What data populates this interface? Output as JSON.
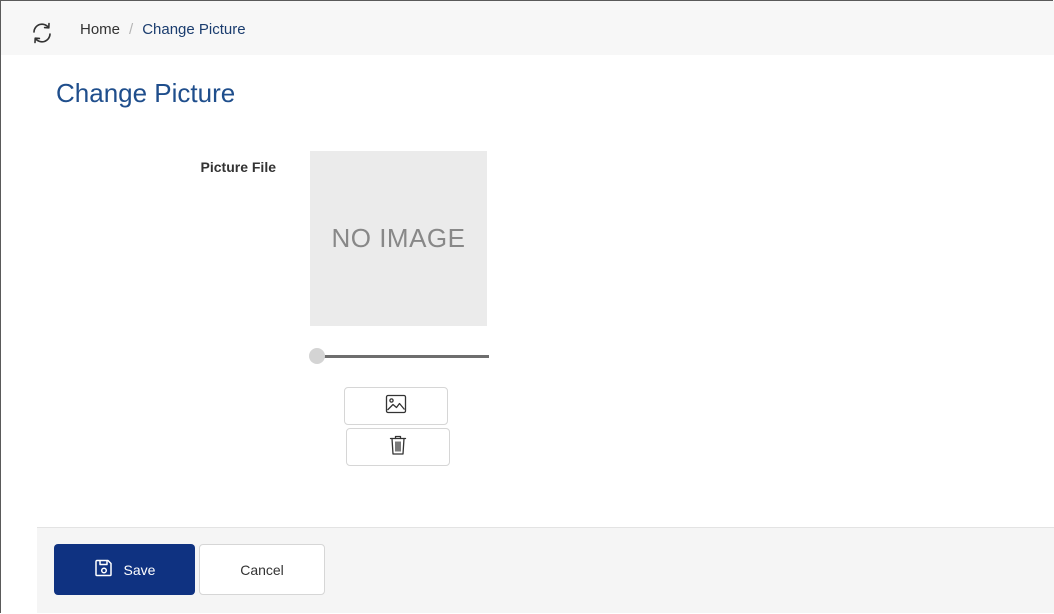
{
  "breadcrumb": {
    "home": "Home",
    "separator": "/",
    "current": "Change Picture"
  },
  "page": {
    "title": "Change Picture"
  },
  "form": {
    "picture_label": "Picture File",
    "placeholder_text": "NO IMAGE",
    "zoom_slider_value": 0
  },
  "actions": {
    "save_label": "Save",
    "cancel_label": "Cancel"
  },
  "icons": {
    "refresh": "refresh-icon",
    "image": "image-icon",
    "delete": "trash-icon",
    "save": "save-icon"
  },
  "colors": {
    "primary": "#0f3281",
    "title": "#1f4e8c",
    "preview_bg": "#ebebeb"
  }
}
